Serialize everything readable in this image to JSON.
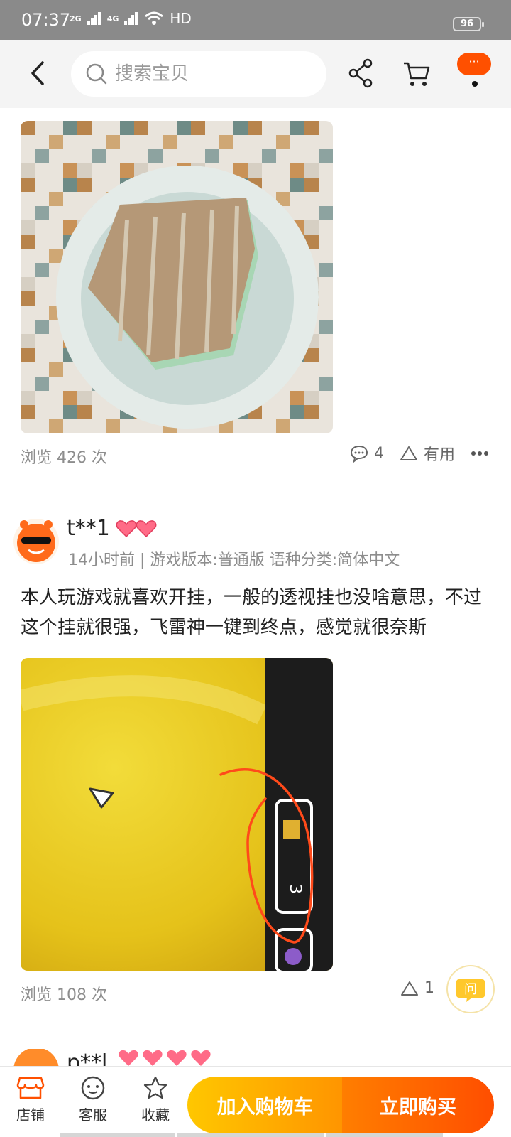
{
  "status_bar": {
    "time": "07:37",
    "network_1": "2G",
    "network_2": "4G",
    "hd": "HD",
    "battery": "96"
  },
  "nav": {
    "search_placeholder": "搜索宝贝",
    "more_label": "···"
  },
  "review1": {
    "views": "浏览 426 次",
    "comments": "4",
    "useful": "有用"
  },
  "review2": {
    "username": "t**1",
    "meta": "14小时前 | 游戏版本:普通版 语种分类:简体中文",
    "text": "本人玩游戏就喜欢开挂，一般的透视挂也没啥意思，不过这个挂就很强，飞雷神一键到终点，感觉就很奈斯",
    "game_number": "3",
    "views": "浏览 108 次",
    "useful_count": "1"
  },
  "review3": {
    "username": "p**l"
  },
  "ask": {
    "label": "问"
  },
  "bottom_bar": {
    "store": "店铺",
    "service": "客服",
    "favorite": "收藏",
    "add_to_cart": "加入购物车",
    "buy_now": "立即购买"
  },
  "colors": {
    "accent": "#ff5000",
    "cart_gradient_start": "#ffc700",
    "buy_gradient_end": "#ff4e00"
  }
}
